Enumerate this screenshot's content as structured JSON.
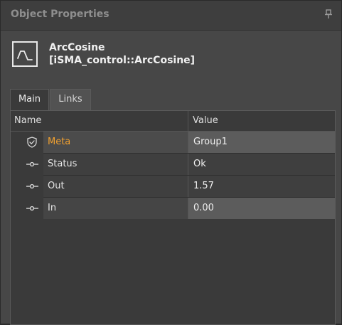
{
  "panel": {
    "title": "Object Properties",
    "pin_icon": "pin-icon"
  },
  "component": {
    "icon": "arccosine-wave-icon",
    "name": "ArcCosine",
    "type": "[iSMA_control::ArcCosine]"
  },
  "tabs": [
    {
      "label": "Main",
      "active": true
    },
    {
      "label": "Links",
      "active": false
    }
  ],
  "table": {
    "columns": [
      "Name",
      "Value"
    ],
    "rows": [
      {
        "icon": "shield-check-icon",
        "name": "Meta",
        "value": "Group1"
      },
      {
        "icon": "slot-connector-icon",
        "name": "Status",
        "value": "Ok"
      },
      {
        "icon": "slot-connector-icon",
        "name": "Out",
        "value": "1.57"
      },
      {
        "icon": "slot-connector-icon",
        "name": "In",
        "value": "0.00"
      }
    ]
  },
  "colors": {
    "meta_label": "#f0a030",
    "panel_bg": "#474747",
    "table_bg": "#3a3a3a"
  }
}
